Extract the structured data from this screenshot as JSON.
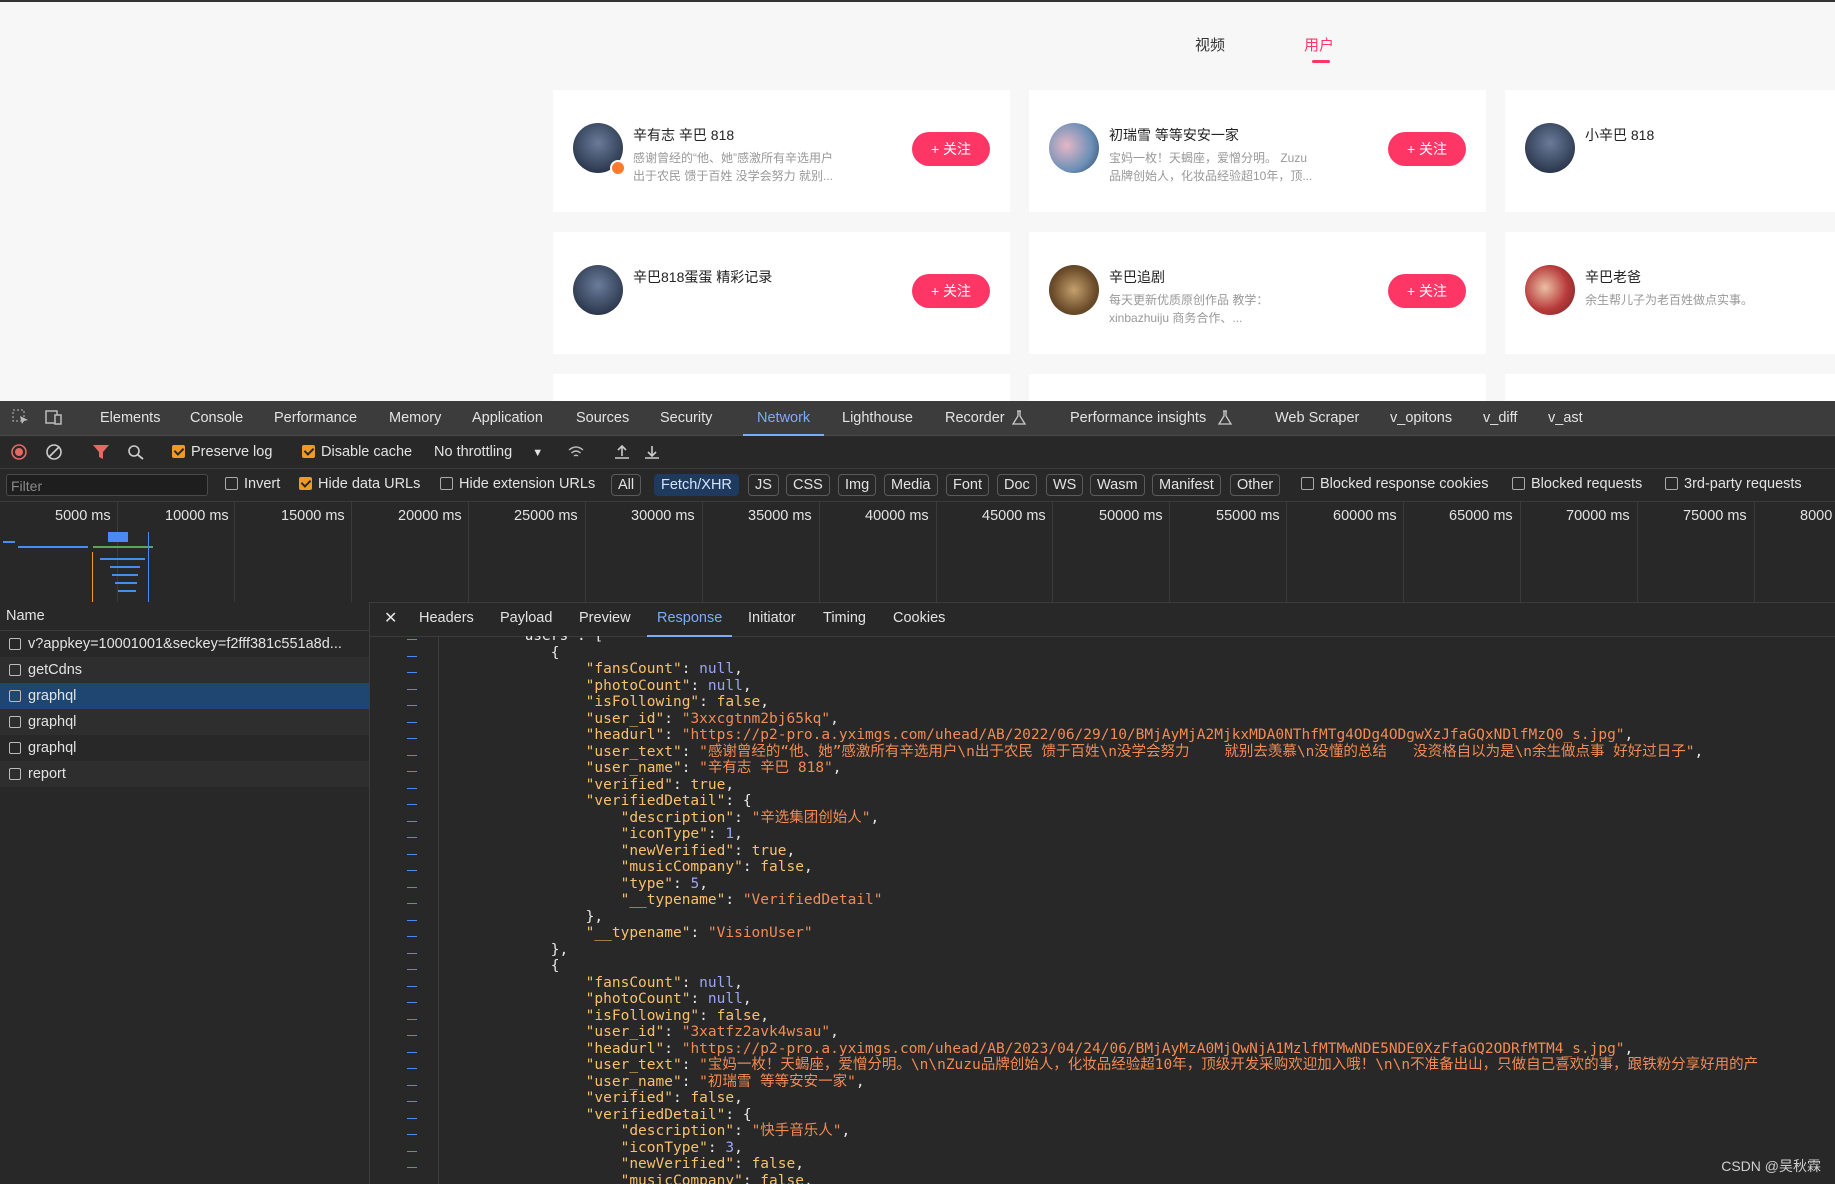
{
  "tabs": {
    "video": "视频",
    "user": "用户"
  },
  "cards": [
    {
      "name": "辛有志 辛巴 818",
      "desc1": "感谢曾经的“他、她”感激所有辛选用户",
      "desc2": "出于农民 馈于百姓 没学会努力 就别...",
      "follow": "+ 关注"
    },
    {
      "name": "初瑞雪 等等安安一家",
      "desc1": "宝妈一枚！天蝎座，爱憎分明。 Zuzu",
      "desc2": "品牌创始人，化妆品经验超10年，顶...",
      "follow": "+ 关注"
    },
    {
      "name": "小辛巴 818",
      "desc1": "",
      "desc2": ""
    },
    {
      "name": "辛巴818蛋蛋 精彩记录",
      "desc1": "",
      "desc2": "",
      "follow": "+ 关注"
    },
    {
      "name": "辛巴追剧",
      "desc1": "每天更新优质原创作品 教学：",
      "desc2": "xinbazhuiju 商务合作、...",
      "follow": "+ 关注"
    },
    {
      "name": "辛巴老爸",
      "desc1": "余生帮儿子为老百姓做点实事。",
      "desc2": ""
    }
  ],
  "devtools": {
    "tabs": [
      "Elements",
      "Console",
      "Performance",
      "Memory",
      "Application",
      "Sources",
      "Security",
      "Network",
      "Lighthouse",
      "Recorder",
      "Performance insights",
      "Web Scraper",
      "v_opitons",
      "v_diff",
      "v_ast"
    ],
    "active_tab": "Network",
    "toolbar": {
      "preserve_log": "Preserve log",
      "disable_cache": "Disable cache",
      "throttling": "No throttling"
    },
    "filter": {
      "placeholder": "Filter",
      "invert": "Invert",
      "hide_data_urls": "Hide data URLs",
      "hide_extension_urls": "Hide extension URLs",
      "types": [
        "All",
        "Fetch/XHR",
        "JS",
        "CSS",
        "Img",
        "Media",
        "Font",
        "Doc",
        "WS",
        "Wasm",
        "Manifest",
        "Other"
      ],
      "selected_type": "Fetch/XHR",
      "blocked_cookies": "Blocked response cookies",
      "blocked_requests": "Blocked requests",
      "third_party": "3rd-party requests"
    },
    "timeline_ticks": [
      "5000 ms",
      "10000 ms",
      "15000 ms",
      "20000 ms",
      "25000 ms",
      "30000 ms",
      "35000 ms",
      "40000 ms",
      "45000 ms",
      "50000 ms",
      "55000 ms",
      "60000 ms",
      "65000 ms",
      "70000 ms",
      "75000 ms",
      "8000"
    ],
    "requests_header": "Name",
    "requests": [
      "v?appkey=10001001&seckey=f2fff381c551a8d...",
      "getCdns",
      "graphql",
      "graphql",
      "graphql",
      "report"
    ],
    "selected_request_index": 2,
    "detail_tabs": [
      "Headers",
      "Payload",
      "Preview",
      "Response",
      "Initiator",
      "Timing",
      "Cookies"
    ],
    "active_detail_tab": "Response",
    "code": [
      [
        {
          "t": "b",
          "v": "        \"users\": ["
        }
      ],
      [
        {
          "t": "b",
          "v": "            {"
        }
      ],
      [
        {
          "t": "k",
          "v": "                \"fansCount\""
        },
        {
          "t": "b",
          "v": ": "
        },
        {
          "t": "n",
          "v": "null"
        },
        {
          "t": "b",
          "v": ","
        }
      ],
      [
        {
          "t": "k",
          "v": "                \"photoCount\""
        },
        {
          "t": "b",
          "v": ": "
        },
        {
          "t": "n",
          "v": "null"
        },
        {
          "t": "b",
          "v": ","
        }
      ],
      [
        {
          "t": "k",
          "v": "                \"isFollowing\""
        },
        {
          "t": "b",
          "v": ": "
        },
        {
          "t": "k",
          "v": "false"
        },
        {
          "t": "b",
          "v": ","
        }
      ],
      [
        {
          "t": "k",
          "v": "                \"user_id\""
        },
        {
          "t": "b",
          "v": ": "
        },
        {
          "t": "s",
          "v": "\"3xxcgtnm2bj65kq\""
        },
        {
          "t": "b",
          "v": ","
        }
      ],
      [
        {
          "t": "k",
          "v": "                \"headurl\""
        },
        {
          "t": "b",
          "v": ": "
        },
        {
          "t": "s",
          "v": "\"https://p2-pro.a.yximgs.com/uhead/AB/2022/06/29/10/BMjAyMjA2MjkxMDA0NThfMTg4ODg4ODgwXzJfaGQxNDlfMzQ0_s.jpg\""
        },
        {
          "t": "b",
          "v": ","
        }
      ],
      [
        {
          "t": "k",
          "v": "                \"user_text\""
        },
        {
          "t": "b",
          "v": ": "
        },
        {
          "t": "s",
          "v": "\"感谢曾经的“他、她”感激所有辛选用户\\n出于农民 馈于百姓\\n没学会努力    就别去羡慕\\n没懂的总结   没资格自以为是\\n余生做点事 好好过日子\""
        },
        {
          "t": "b",
          "v": ","
        }
      ],
      [
        {
          "t": "k",
          "v": "                \"user_name\""
        },
        {
          "t": "b",
          "v": ": "
        },
        {
          "t": "s",
          "v": "\"辛有志 辛巴 818\""
        },
        {
          "t": "b",
          "v": ","
        }
      ],
      [
        {
          "t": "k",
          "v": "                \"verified\""
        },
        {
          "t": "b",
          "v": ": "
        },
        {
          "t": "k",
          "v": "true"
        },
        {
          "t": "b",
          "v": ","
        }
      ],
      [
        {
          "t": "k",
          "v": "                \"verifiedDetail\""
        },
        {
          "t": "b",
          "v": ": {"
        }
      ],
      [
        {
          "t": "k",
          "v": "                    \"description\""
        },
        {
          "t": "b",
          "v": ": "
        },
        {
          "t": "s",
          "v": "\"辛选集团创始人\""
        },
        {
          "t": "b",
          "v": ","
        }
      ],
      [
        {
          "t": "k",
          "v": "                    \"iconType\""
        },
        {
          "t": "b",
          "v": ": "
        },
        {
          "t": "n",
          "v": "1"
        },
        {
          "t": "b",
          "v": ","
        }
      ],
      [
        {
          "t": "k",
          "v": "                    \"newVerified\""
        },
        {
          "t": "b",
          "v": ": "
        },
        {
          "t": "k",
          "v": "true"
        },
        {
          "t": "b",
          "v": ","
        }
      ],
      [
        {
          "t": "k",
          "v": "                    \"musicCompany\""
        },
        {
          "t": "b",
          "v": ": "
        },
        {
          "t": "k",
          "v": "false"
        },
        {
          "t": "b",
          "v": ","
        }
      ],
      [
        {
          "t": "k",
          "v": "                    \"type\""
        },
        {
          "t": "b",
          "v": ": "
        },
        {
          "t": "n",
          "v": "5"
        },
        {
          "t": "b",
          "v": ","
        }
      ],
      [
        {
          "t": "k",
          "v": "                    \"__typename\""
        },
        {
          "t": "b",
          "v": ": "
        },
        {
          "t": "s",
          "v": "\"VerifiedDetail\""
        }
      ],
      [
        {
          "t": "b",
          "v": "                },"
        }
      ],
      [
        {
          "t": "k",
          "v": "                \"__typename\""
        },
        {
          "t": "b",
          "v": ": "
        },
        {
          "t": "s",
          "v": "\"VisionUser\""
        }
      ],
      [
        {
          "t": "b",
          "v": "            },"
        }
      ],
      [
        {
          "t": "b",
          "v": "            {"
        }
      ],
      [
        {
          "t": "k",
          "v": "                \"fansCount\""
        },
        {
          "t": "b",
          "v": ": "
        },
        {
          "t": "n",
          "v": "null"
        },
        {
          "t": "b",
          "v": ","
        }
      ],
      [
        {
          "t": "k",
          "v": "                \"photoCount\""
        },
        {
          "t": "b",
          "v": ": "
        },
        {
          "t": "n",
          "v": "null"
        },
        {
          "t": "b",
          "v": ","
        }
      ],
      [
        {
          "t": "k",
          "v": "                \"isFollowing\""
        },
        {
          "t": "b",
          "v": ": "
        },
        {
          "t": "k",
          "v": "false"
        },
        {
          "t": "b",
          "v": ","
        }
      ],
      [
        {
          "t": "k",
          "v": "                \"user_id\""
        },
        {
          "t": "b",
          "v": ": "
        },
        {
          "t": "s",
          "v": "\"3xatfz2avk4wsau\""
        },
        {
          "t": "b",
          "v": ","
        }
      ],
      [
        {
          "t": "k",
          "v": "                \"headurl\""
        },
        {
          "t": "b",
          "v": ": "
        },
        {
          "t": "s",
          "v": "\"https://p2-pro.a.yximgs.com/uhead/AB/2023/04/24/06/BMjAyMzA0MjQwNjA1MzlfMTMwNDE5NDE0XzFfaGQ2ODRfMTM4_s.jpg\""
        },
        {
          "t": "b",
          "v": ","
        }
      ],
      [
        {
          "t": "k",
          "v": "                \"user_text\""
        },
        {
          "t": "b",
          "v": ": "
        },
        {
          "t": "s",
          "v": "\"宝妈一枚！天蝎座，爱憎分明。\\n\\nZuzu品牌创始人，化妆品经验超10年，顶级开发采购欢迎加入哦！\\n\\n不准备出山，只做自己喜欢的事，跟铁粉分享好用的产"
        }
      ],
      [
        {
          "t": "k",
          "v": "                \"user_name\""
        },
        {
          "t": "b",
          "v": ": "
        },
        {
          "t": "s",
          "v": "\"初瑞雪 等等安安一家\""
        },
        {
          "t": "b",
          "v": ","
        }
      ],
      [
        {
          "t": "k",
          "v": "                \"verified\""
        },
        {
          "t": "b",
          "v": ": "
        },
        {
          "t": "k",
          "v": "false"
        },
        {
          "t": "b",
          "v": ","
        }
      ],
      [
        {
          "t": "k",
          "v": "                \"verifiedDetail\""
        },
        {
          "t": "b",
          "v": ": {"
        }
      ],
      [
        {
          "t": "k",
          "v": "                    \"description\""
        },
        {
          "t": "b",
          "v": ": "
        },
        {
          "t": "s",
          "v": "\"快手音乐人\""
        },
        {
          "t": "b",
          "v": ","
        }
      ],
      [
        {
          "t": "k",
          "v": "                    \"iconType\""
        },
        {
          "t": "b",
          "v": ": "
        },
        {
          "t": "n",
          "v": "3"
        },
        {
          "t": "b",
          "v": ","
        }
      ],
      [
        {
          "t": "k",
          "v": "                    \"newVerified\""
        },
        {
          "t": "b",
          "v": ": "
        },
        {
          "t": "k",
          "v": "false"
        },
        {
          "t": "b",
          "v": ","
        }
      ],
      [
        {
          "t": "k",
          "v": "                    \"musicCompany\""
        },
        {
          "t": "b",
          "v": ": "
        },
        {
          "t": "k",
          "v": "false"
        },
        {
          "t": "b",
          "v": ","
        }
      ]
    ]
  },
  "watermark": "CSDN @吴秋霖"
}
